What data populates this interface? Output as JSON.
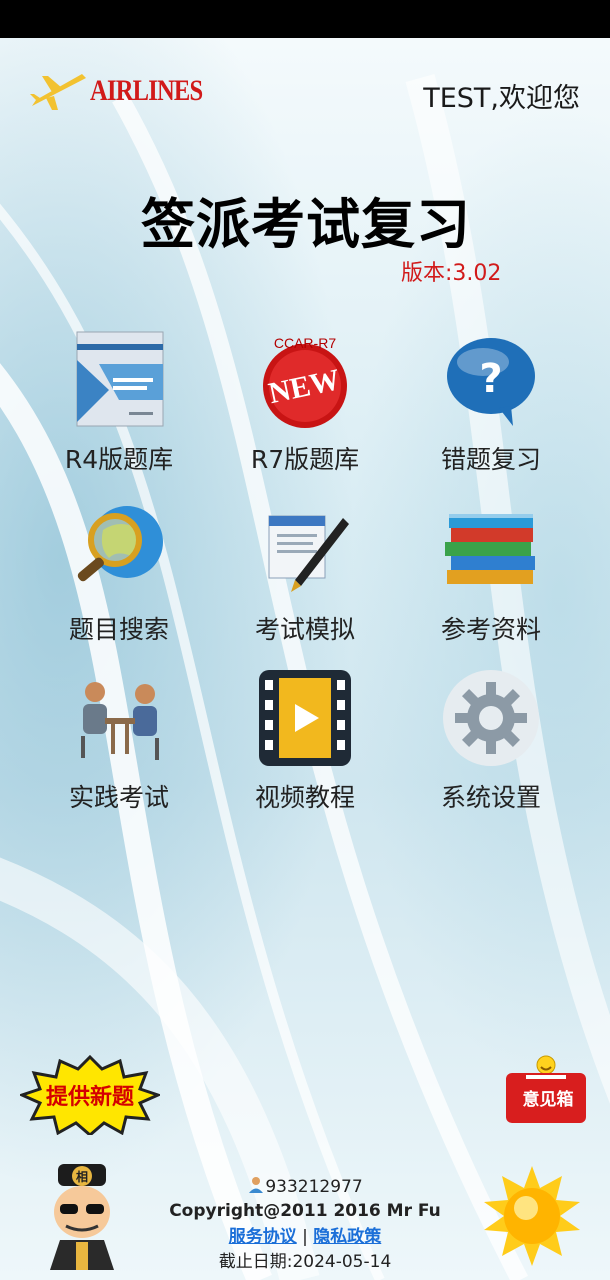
{
  "header": {
    "logo_text": "AIRLINES",
    "welcome": "TEST,欢迎您"
  },
  "title": "签派考试复习",
  "version": "版本:3.02",
  "menu": [
    {
      "label": "R4版题库",
      "icon": "book-cover-icon"
    },
    {
      "label": "R7版题库",
      "icon": "new-badge-icon",
      "badge_text": "CCAR-R7",
      "badge_word": "NEW"
    },
    {
      "label": "错题复习",
      "icon": "question-bubble-icon"
    },
    {
      "label": "题目搜索",
      "icon": "magnifier-globe-icon"
    },
    {
      "label": "考试模拟",
      "icon": "pen-document-icon"
    },
    {
      "label": "参考资料",
      "icon": "books-stack-icon"
    },
    {
      "label": "实践考试",
      "icon": "interview-people-icon"
    },
    {
      "label": "视频教程",
      "icon": "film-play-icon"
    },
    {
      "label": "系统设置",
      "icon": "gear-icon"
    }
  ],
  "actions": {
    "new_question": "提供新题",
    "suggestion_box": "意见箱"
  },
  "footer": {
    "qq": "933212977",
    "copyright": "Copyright@2011 2016 Mr Fu",
    "service_agreement": "服务协议",
    "separator": " | ",
    "privacy_policy": "隐私政策",
    "deadline": "截止日期:2024-05-14"
  },
  "colors": {
    "brand_red": "#d11a1a",
    "link_blue": "#1b6fd8"
  }
}
